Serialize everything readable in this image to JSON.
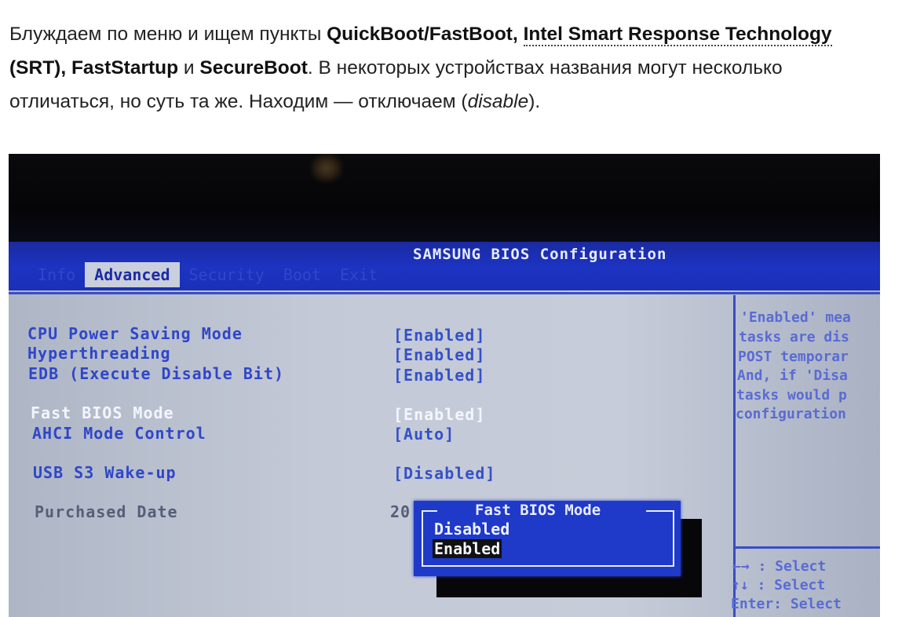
{
  "article": {
    "p1_a": "Блуждаем по меню и ищем пункты ",
    "term1": "QuickBoot/FastBoot",
    "p1_b": ", ",
    "term2": "Intel Smart Response Technology",
    "p1_c": " (SRT), ",
    "term3": "FastStartup",
    "p1_d": " и ",
    "term4": "SecureBoot",
    "p1_e": ". В некоторых устройствах названия могут несколько отличаться, но суть та же. Находим — отключаем (",
    "term5": "disable",
    "p1_f": ")."
  },
  "bios": {
    "title": "SAMSUNG BIOS Configuration",
    "tabs": [
      "Info",
      "Advanced",
      "Security",
      "Boot",
      "Exit"
    ],
    "active_tab": "Advanced",
    "settings": [
      {
        "label": "CPU Power Saving Mode",
        "value": "[Enabled]"
      },
      {
        "label": "Hyperthreading",
        "value": "[Enabled]"
      },
      {
        "label": "EDB (Execute Disable Bit)",
        "value": "[Enabled]"
      },
      {
        "label": "Fast BIOS Mode",
        "value": "[Enabled]"
      },
      {
        "label": "AHCI Mode Control",
        "value": "[Auto]"
      },
      {
        "label": "USB S3 Wake-up",
        "value": "[Disabled]"
      },
      {
        "label": "Purchased Date",
        "value": "20"
      }
    ],
    "help_lines": [
      "'Enabled' mea",
      "tasks are dis",
      "POST temporar",
      "And, if 'Disa",
      "tasks would p",
      "configuration"
    ],
    "key_hints": [
      "←→   : Select",
      "↑↓   : Select",
      "Enter: Select"
    ],
    "popup": {
      "title": "Fast BIOS Mode",
      "options": [
        "Disabled",
        "Enabled"
      ],
      "selected": "Enabled"
    }
  },
  "colors": {
    "bios_blue": "#1d33c2",
    "bios_gray": "#c3c9d6",
    "popup_blue": "#1f39c9"
  }
}
